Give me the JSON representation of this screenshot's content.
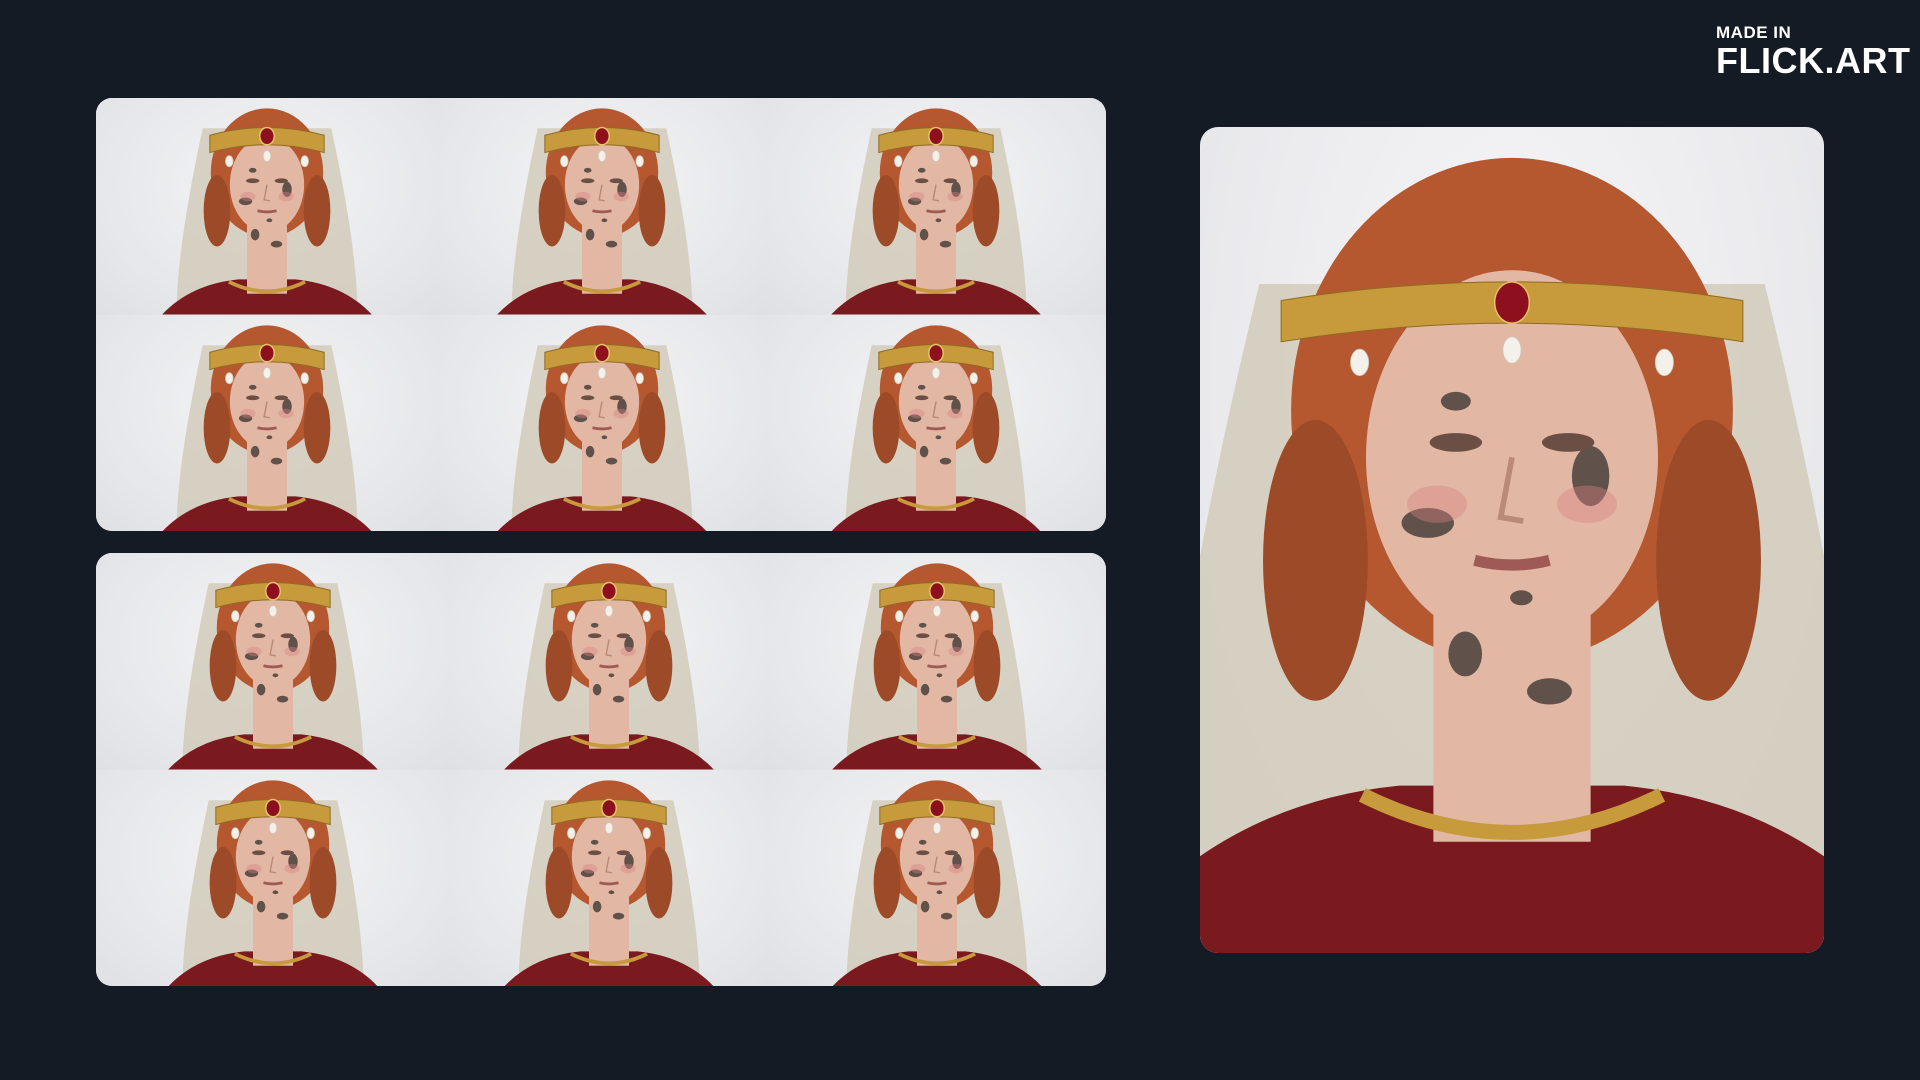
{
  "watermark": {
    "line1": "MADE IN",
    "line2": "FLICK.ART"
  },
  "colors": {
    "background": "#141b24",
    "card_bg": "#ececef",
    "hair": "#b5582f",
    "skin": "#e2b7a4",
    "gold": "#c79a3c",
    "garnet": "#8e0f1e",
    "dress": "#7a1a1f",
    "veil": "#cfc7b4",
    "soot": "#2a2624"
  },
  "grids": [
    {
      "name": "expression-grid-top",
      "rows": 2,
      "cols": 3
    },
    {
      "name": "expression-grid-bottom",
      "rows": 2,
      "cols": 3
    }
  ],
  "hero": {
    "icon": "portrait-closeup"
  }
}
